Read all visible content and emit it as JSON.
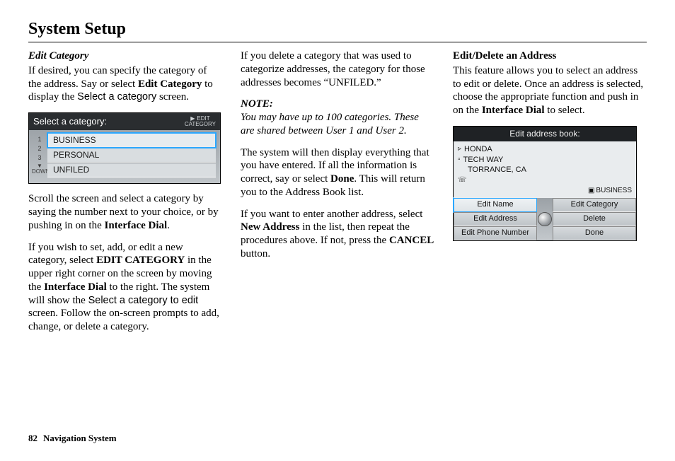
{
  "page": {
    "title": "System Setup",
    "page_number": "82",
    "footer_text": "Navigation System"
  },
  "col1": {
    "heading": "Edit Category",
    "p1a": "If desired, you can specify the category of the address. Say or select ",
    "p1b": "Edit Category",
    "p1c": " to display the ",
    "p1d": "Select a category",
    "p1e": " screen.",
    "p2a": "Scroll the screen and select a category by saying the number next to your choice, or by pushing in on the ",
    "p2b": "Interface Dial",
    "p2c": ".",
    "p3a": "If you wish to set, add, or edit a new category, select ",
    "p3b": "EDIT CATEGORY",
    "p3c": " in the upper right corner on the screen by moving the ",
    "p3d": "Interface Dial",
    "p3e": " to the right. The system will show the ",
    "p3f": "Select a category to edit",
    "p3g": " screen. Follow the on-screen prompts to add, change, or delete a category."
  },
  "col2": {
    "p1": "If you delete a category that was used to categorize addresses, the category for those addresses becomes “UNFILED.”",
    "note_label": "NOTE:",
    "note_body": "You may have up to 100 categories. These are shared between User 1 and User 2.",
    "p2a": "The system will then display everything that you have entered. If all the information is correct, say or select ",
    "p2b": "Done",
    "p2c": ". This will return you to the Address Book list.",
    "p3a": "If you want to enter another address, select ",
    "p3b": "New Address",
    "p3c": " in the list, then repeat the procedures above. If not, press the ",
    "p3d": "CANCEL",
    "p3e": " button."
  },
  "col3": {
    "heading": "Edit/Delete an Address",
    "p1a": "This feature allows you to select an address to edit or delete. Once an address is selected, choose the appropriate function and push in on the ",
    "p1b": "Interface Dial",
    "p1c": " to select."
  },
  "shot1": {
    "title": "Select a category:",
    "edit_line1": "EDIT",
    "edit_line2": "CATEGORY",
    "nums": {
      "n1": "1",
      "n2": "2",
      "n3": "3",
      "down_arrow": "▼",
      "down_label": "DOWN"
    },
    "items": {
      "i1": "BUSINESS",
      "i2": "PERSONAL",
      "i3": "UNFILED"
    }
  },
  "shot2": {
    "title": "Edit address book:",
    "line1": "HONDA",
    "line2": "TECH WAY",
    "line3": "TORRANCE, CA",
    "biz": "BUSINESS",
    "btns": {
      "b11": "Edit Name",
      "b12": "Edit Category",
      "b21": "Edit Address",
      "b22": "Delete",
      "b31": "Edit Phone Number",
      "b32": "Done"
    }
  }
}
